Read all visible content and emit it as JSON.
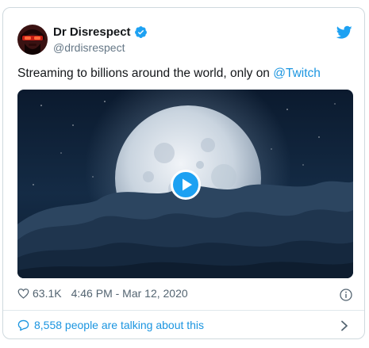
{
  "tweet": {
    "author_name": "Dr Disrespect",
    "handle": "@drdisrespect",
    "text_prefix": "Streaming to billions around the world, only on ",
    "mention": "@Twitch",
    "likes": "63.1K",
    "timestamp": "4:46 PM - Mar 12, 2020",
    "talking": "8,558 people are talking about this"
  },
  "icons": {
    "verified": "verified-badge-icon",
    "brand": "twitter-bird-icon",
    "like": "heart-icon",
    "info": "info-icon",
    "talk": "speech-bubble-icon",
    "chevron": "chevron-right-icon",
    "play": "play-icon"
  },
  "colors": {
    "accent": "#1da1f2",
    "link": "#1b95e0",
    "text": "#14171a",
    "muted": "#657786",
    "border": "#cfd9de"
  }
}
